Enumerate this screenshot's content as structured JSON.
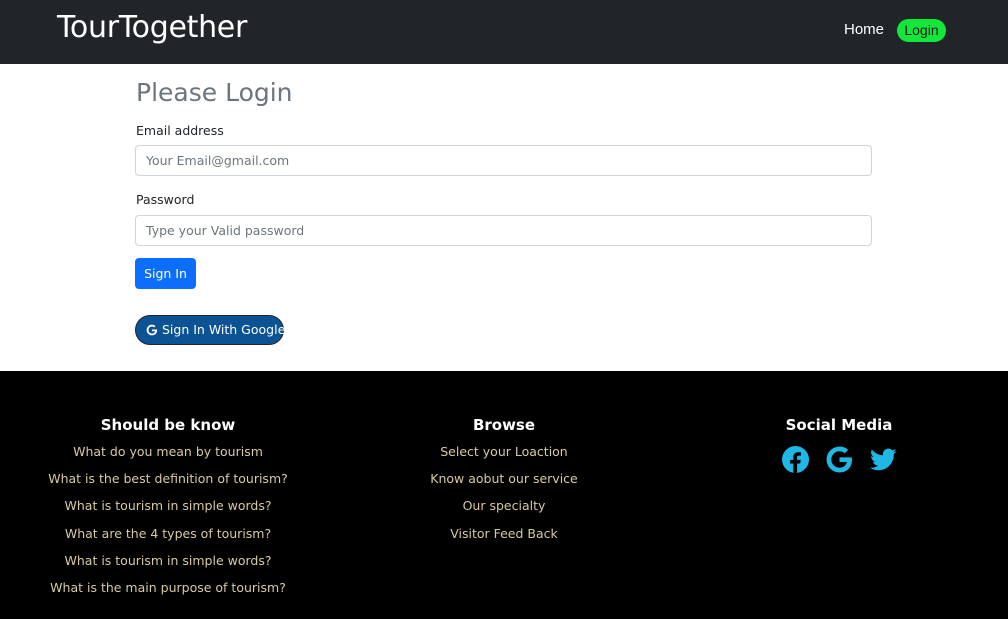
{
  "navbar": {
    "brand": "TourTogether",
    "home_label": "Home",
    "login_label": "Login"
  },
  "login": {
    "title": "Please Login",
    "email_label": "Email address",
    "email_placeholder": "Your Email@gmail.com",
    "password_label": "Password",
    "password_placeholder": "Type your Valid password",
    "signin_label": "Sign In",
    "google_label": "Sign In With Google"
  },
  "footer": {
    "know": {
      "heading": "Should be know",
      "items": [
        "What do you mean by tourism",
        "What is the best definition of tourism?",
        "What is tourism in simple words?",
        "What are the 4 types of tourism?",
        "What is tourism in simple words?",
        "What is the main purpose of tourism?"
      ]
    },
    "browse": {
      "heading": "Browse",
      "items": [
        "Select your Loaction",
        "Know aobut our service",
        "Our specialty",
        "Visitor Feed Back"
      ]
    },
    "social": {
      "heading": "Social Media",
      "icons": [
        "facebook-icon",
        "google-icon",
        "twitter-icon"
      ],
      "icon_color": "#1fb8e6"
    }
  },
  "colors": {
    "navbar_bg": "#212529",
    "login_badge": "#12e73a",
    "primary_button": "#0d6efd",
    "google_button": "#0b5394",
    "footer_bg": "#000000",
    "footer_link": "#d9c9a3"
  }
}
